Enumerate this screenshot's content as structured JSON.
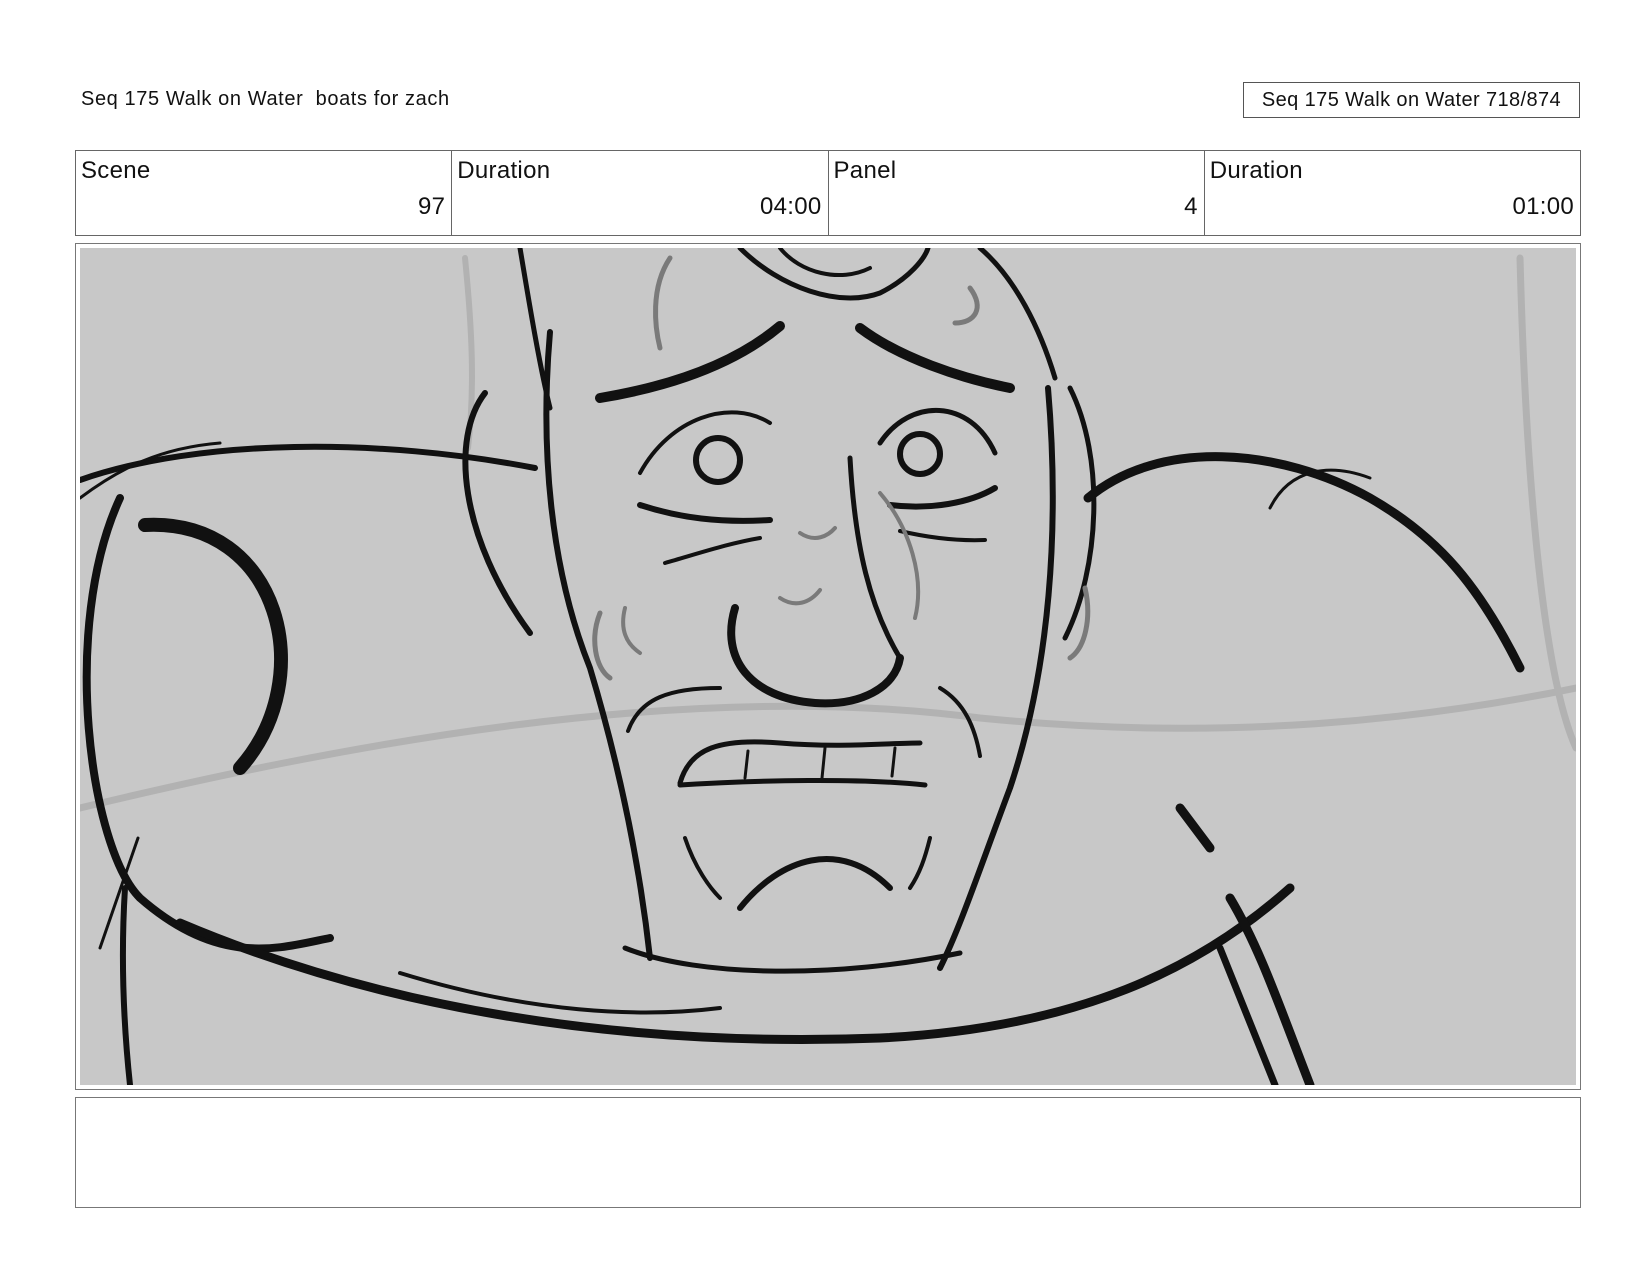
{
  "header": {
    "title": "Seq 175 Walk on Water  boats for zach",
    "page_label": "Seq 175 Walk on Water 718/874"
  },
  "info": {
    "scene_label": "Scene",
    "scene_value": "97",
    "scene_duration_label": "Duration",
    "scene_duration_value": "04:00",
    "panel_label": "Panel",
    "panel_value": "4",
    "panel_duration_label": "Duration",
    "panel_duration_value": "01:00"
  },
  "panel": {
    "background_color": "#c8c8c8",
    "ink_color": "#111111",
    "shade_color": "#7a7a7a"
  },
  "notes": {
    "text": ""
  }
}
